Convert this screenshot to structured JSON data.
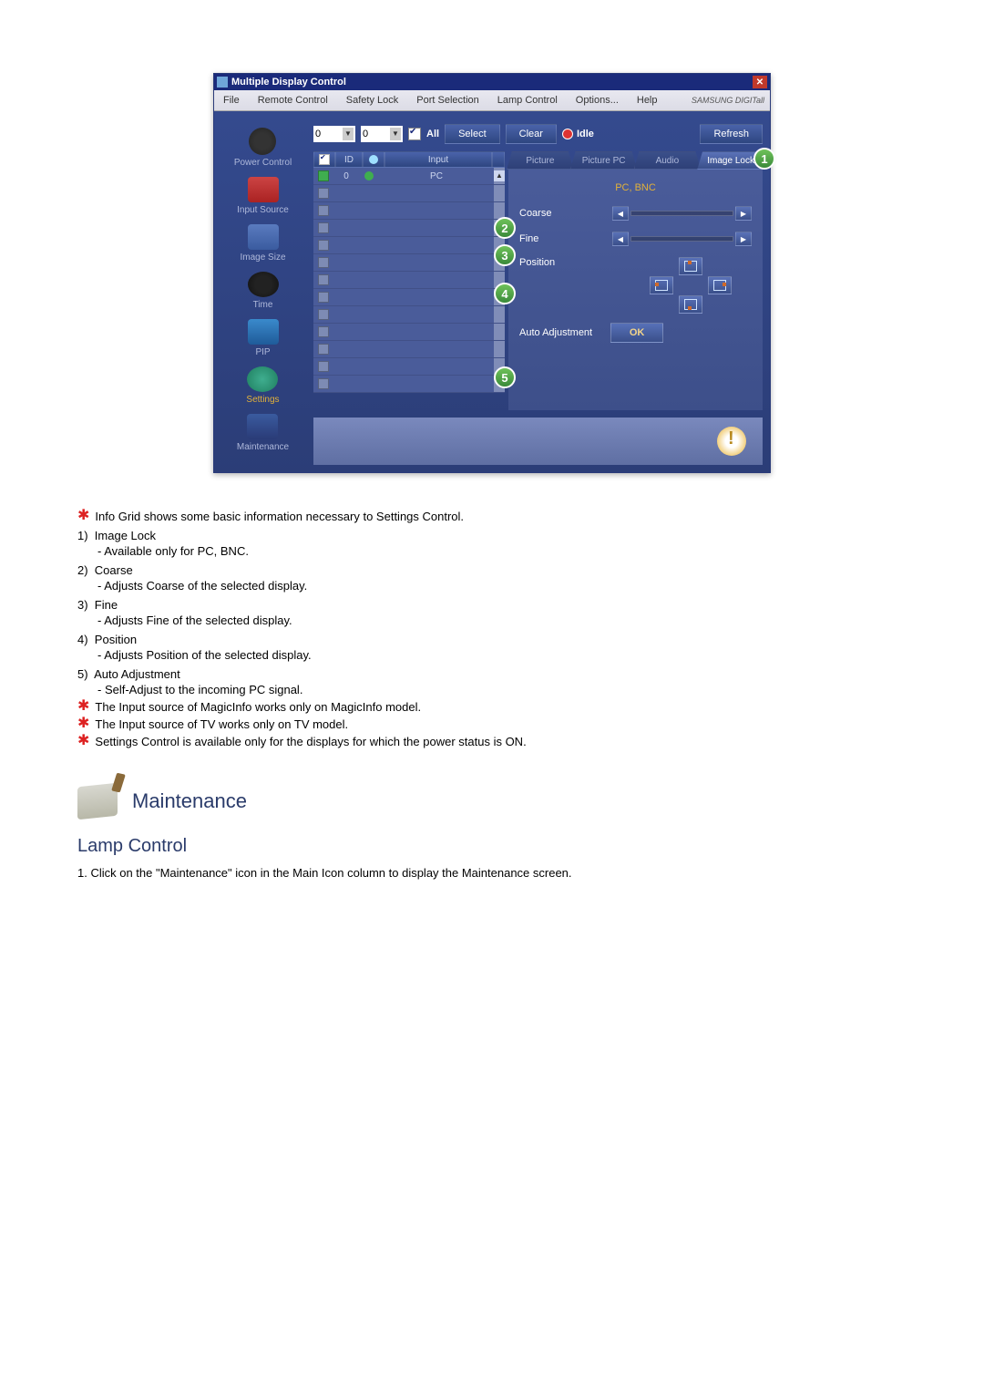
{
  "window": {
    "title": "Multiple Display Control"
  },
  "menu": {
    "items": [
      "File",
      "Remote Control",
      "Safety Lock",
      "Port Selection",
      "Lamp Control",
      "Options...",
      "Help"
    ],
    "brand": "SAMSUNG DIGITall"
  },
  "sidebar": {
    "items": [
      {
        "label": "Power Control"
      },
      {
        "label": "Input Source"
      },
      {
        "label": "Image Size"
      },
      {
        "label": "Time"
      },
      {
        "label": "PIP"
      },
      {
        "label": "Settings"
      },
      {
        "label": "Maintenance"
      }
    ]
  },
  "toolbar": {
    "dd1": "0",
    "dd2": "0",
    "all": "All",
    "select": "Select",
    "clear": "Clear",
    "idle": "Idle",
    "refresh": "Refresh"
  },
  "grid": {
    "headers": {
      "id": "ID",
      "input": "Input"
    },
    "row0": {
      "id": "0",
      "input": "PC"
    }
  },
  "tabs": {
    "items": [
      "Picture",
      "Picture PC",
      "Audio",
      "Image Lock"
    ]
  },
  "panel": {
    "title": "PC, BNC",
    "coarse": "Coarse",
    "fine": "Fine",
    "position": "Position",
    "auto": "Auto Adjustment",
    "ok": "OK"
  },
  "callouts": {
    "c1": "1",
    "c2": "2",
    "c3": "3",
    "c4": "4",
    "c5": "5"
  },
  "notes": {
    "star1": "Info Grid shows some basic information necessary to Settings Control.",
    "items": [
      {
        "num": "1)",
        "title": "Image Lock",
        "sub": "- Available only for PC, BNC."
      },
      {
        "num": "2)",
        "title": "Coarse",
        "sub": "- Adjusts Coarse of the selected display."
      },
      {
        "num": "3)",
        "title": "Fine",
        "sub": "- Adjusts Fine of the selected display."
      },
      {
        "num": "4)",
        "title": "Position",
        "sub": "- Adjusts Position of the selected display."
      },
      {
        "num": "5)",
        "title": "Auto Adjustment",
        "sub": "- Self-Adjust to the incoming PC signal."
      }
    ],
    "star2": "The Input source of MagicInfo works only on MagicInfo model.",
    "star3": "The Input source of TV works only on TV model.",
    "star4": "Settings Control is available only for the displays for which the power status is ON."
  },
  "section": {
    "title": "Maintenance",
    "subtitle": "Lamp Control",
    "line1": "1.  Click on the \"Maintenance\" icon in the Main Icon column to display the Maintenance screen."
  }
}
